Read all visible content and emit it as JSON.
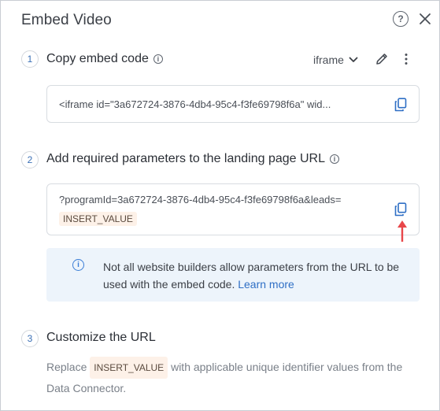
{
  "dialog": {
    "title": "Embed Video",
    "help_icon": "help-circle-icon",
    "close_icon": "close-icon"
  },
  "step1": {
    "number": "1",
    "title": "Copy embed code",
    "info_icon": "info-icon",
    "type_select": "iframe",
    "code": "<iframe id=\"3a672724-3876-4db4-95c4-f3fe69798f6a\" wid...",
    "copy_icon": "copy-icon",
    "edit_icon": "pencil-icon",
    "more_icon": "more-vertical-icon"
  },
  "step2": {
    "number": "2",
    "title": "Add required parameters to the landing page URL",
    "info_icon": "info-icon",
    "url_text": "?programId=3a672724-3876-4db4-95c4-f3fe69798f6a&leads=",
    "url_value_chip": "INSERT_VALUE",
    "copy_icon": "copy-icon",
    "banner": {
      "icon": "info-icon",
      "text": "Not all website builders allow parameters from the URL to be used with the embed code.",
      "link": "Learn more"
    }
  },
  "step3": {
    "number": "3",
    "title": "Customize the URL",
    "desc_prefix": "Replace",
    "desc_chip": "INSERT_VALUE",
    "desc_suffix": "with applicable unique identifier values from the Data Connector."
  },
  "colors": {
    "accent": "#2f6fc5",
    "arrow": "#e8474a",
    "banner_bg": "#edf4fb",
    "chip_bg": "#fdf1e8"
  }
}
